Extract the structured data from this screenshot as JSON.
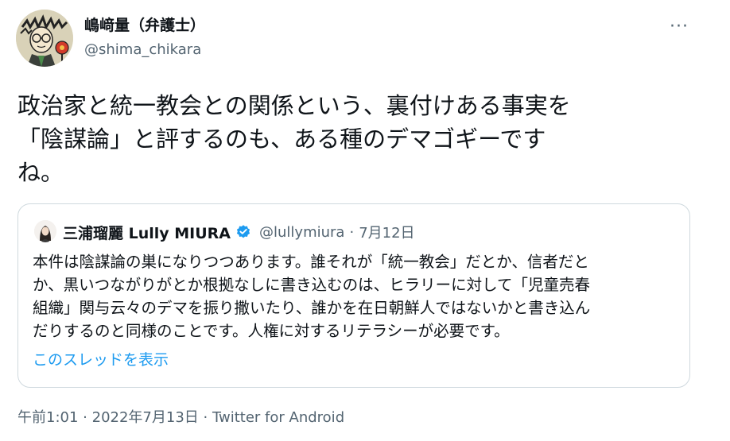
{
  "author": {
    "name": "嶋﨑量（弁護士）",
    "handle": "@shima_chikara",
    "avatar_icon": "illustrated-avatar"
  },
  "more_icon": "more-icon",
  "more_label": "···",
  "tweet": {
    "text": "政治家と統一教会との関係という、裏付けある事実を\n「陰謀論」と評するのも、ある種のデマゴギーです\nね。"
  },
  "quote": {
    "author_name": "三浦瑠麗 Lully MIURA",
    "verified_icon": "verified-badge-icon",
    "handle": "@lullymiura",
    "separator": "·",
    "date": "7月12日",
    "text": "本件は陰謀論の巣になりつつあります。誰それが「統一教会」だとか、信者だと\nか、黒いつながりがとか根拠なしに書き込むのは、ヒラリーに対して「児童売春\n組織」関与云々のデマを振り撒いたり、誰かを在日朝鮮人ではないかと書き込ん\nだりするのと同様のことです。人権に対するリテラシーが必要です。",
    "show_thread_label": "このスレッドを表示"
  },
  "meta": {
    "time": "午前1:01",
    "sep1": "·",
    "date": "2022年7月13日",
    "sep2": "·",
    "source": "Twitter for Android"
  },
  "colors": {
    "link": "#1d9bf0",
    "secondary_text": "#536471",
    "border": "#cfd9de"
  }
}
